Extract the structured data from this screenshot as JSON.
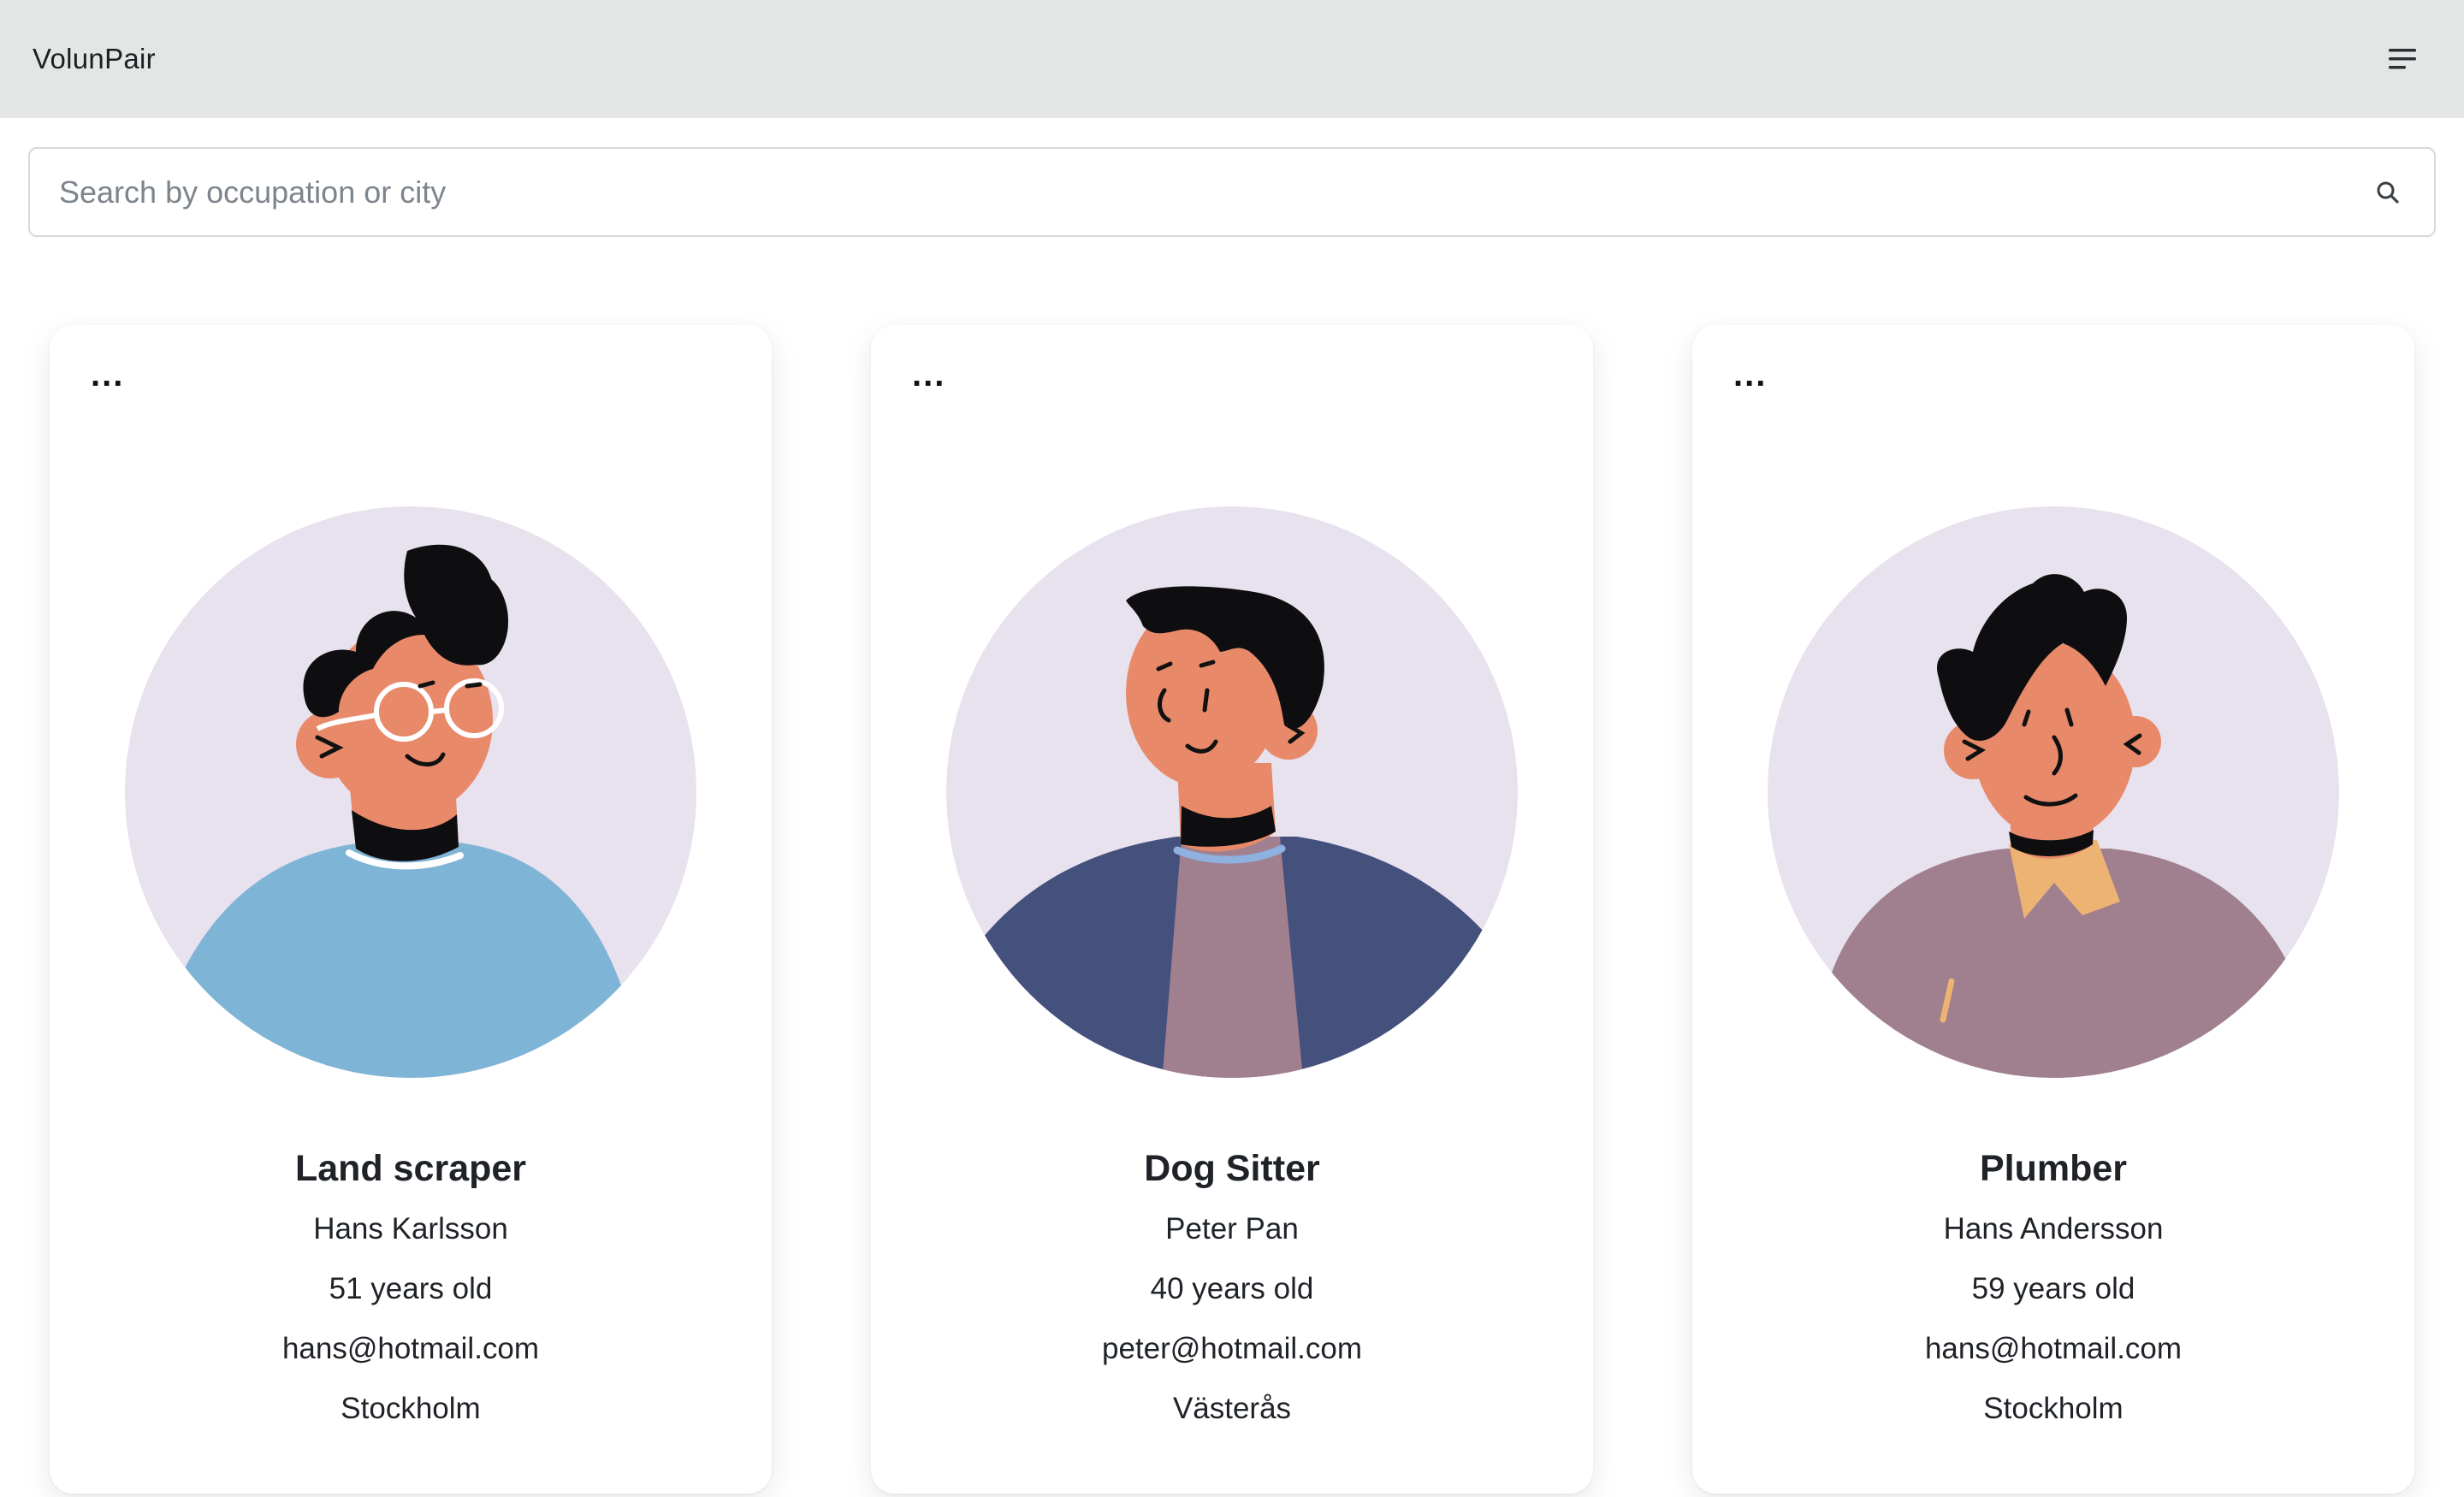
{
  "app": {
    "brand": "VolunPair"
  },
  "search": {
    "placeholder": "Search by occupation or city",
    "value": ""
  },
  "icons": {
    "menu": "menu-lines-icon",
    "search": "search-icon",
    "more": "more-dots-icon"
  },
  "cards": [
    {
      "more_label": "...",
      "occupation": "Land scraper",
      "name": "Hans Karlsson",
      "age": "51 years old",
      "email": "hans@hotmail.com",
      "city": "Stockholm"
    },
    {
      "more_label": "...",
      "occupation": "Dog Sitter",
      "name": "Peter Pan",
      "age": "40 years old",
      "email": "peter@hotmail.com",
      "city": "Västerås"
    },
    {
      "more_label": "...",
      "occupation": "Plumber",
      "name": "Hans Andersson",
      "age": "59 years old",
      "email": "hans@hotmail.com",
      "city": "Stockholm"
    }
  ]
}
